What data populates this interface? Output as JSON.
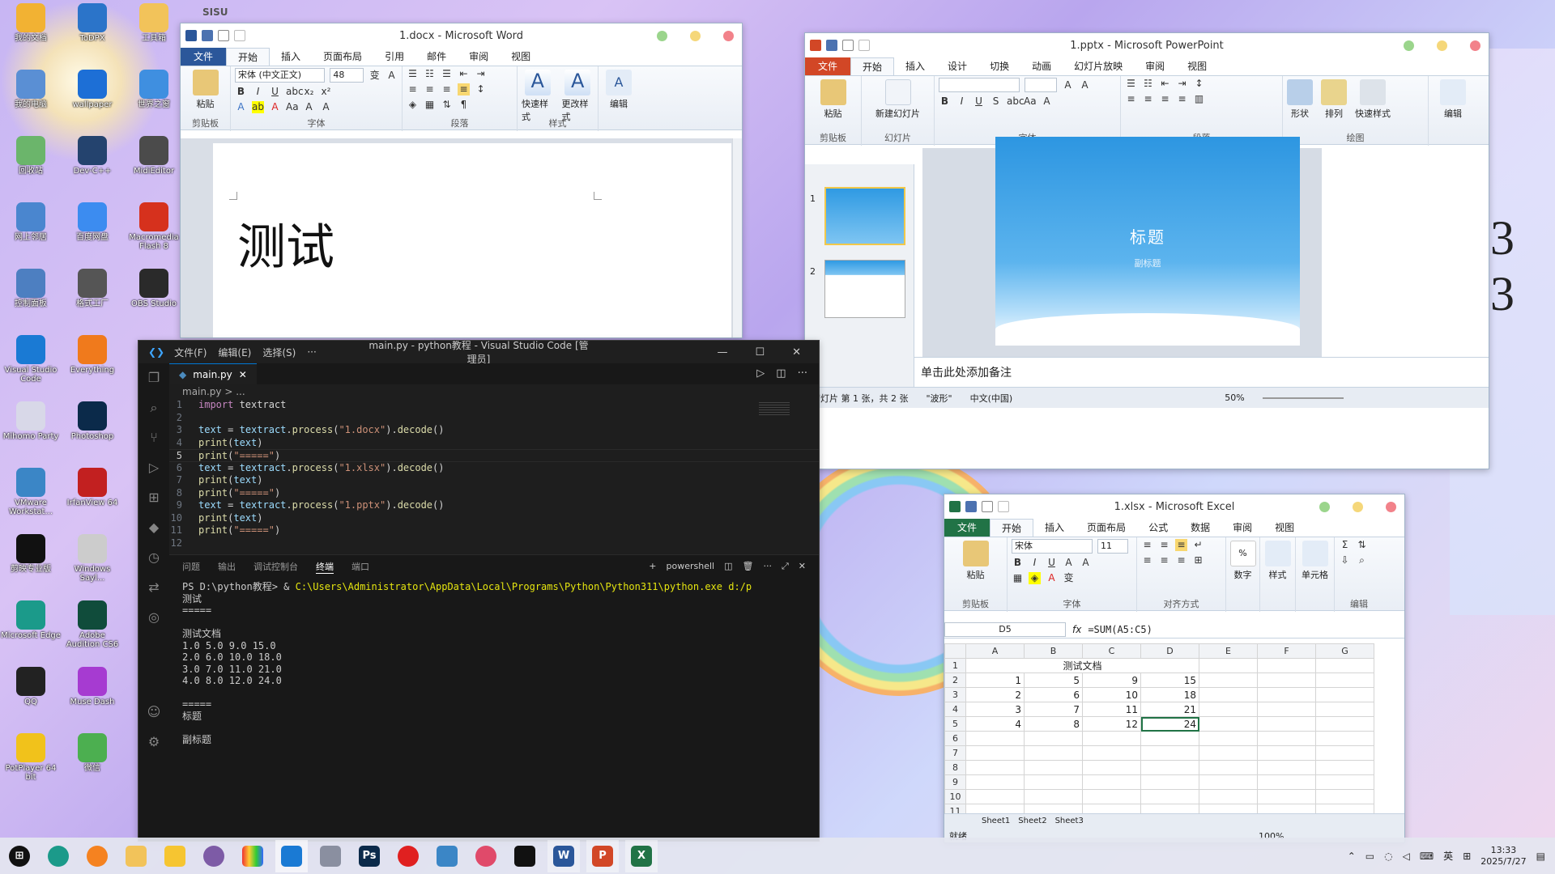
{
  "desktop": {
    "icons": [
      {
        "label": "我的文档",
        "color": "#f2b233"
      },
      {
        "label": "ToDPX",
        "color": "#2b74c9"
      },
      {
        "label": "工具箱",
        "color": "#f2c35a"
      },
      {
        "label": "我的电脑",
        "color": "#5a8fd4"
      },
      {
        "label": "wallpaper",
        "color": "#1d6fd6"
      },
      {
        "label": "世界之窗",
        "color": "#3f8fe0"
      },
      {
        "label": "回收站",
        "color": "#6bb56b"
      },
      {
        "label": "Dev-C++",
        "color": "#24436e"
      },
      {
        "label": "MidiEditor",
        "color": "#4b4b4b"
      },
      {
        "label": "网上邻居",
        "color": "#4a86cf"
      },
      {
        "label": "百度网盘",
        "color": "#3c8cf0"
      },
      {
        "label": "Macromedia Flash 8",
        "color": "#d6311d"
      },
      {
        "label": "控制面板",
        "color": "#4d7fc1"
      },
      {
        "label": "格式工厂",
        "color": "#555555"
      },
      {
        "label": "OBS Studio",
        "color": "#2a2a2a"
      },
      {
        "label": "Visual Studio Code",
        "color": "#1a7ad4"
      },
      {
        "label": "Everything",
        "color": "#f07a1c"
      },
      {
        "label": "",
        "color": "transparent"
      },
      {
        "label": "Mihomo Party",
        "color": "#d8d8e8"
      },
      {
        "label": "Photoshop",
        "color": "#0b2a4a"
      },
      {
        "label": "",
        "color": "transparent"
      },
      {
        "label": "VMware Workstat...",
        "color": "#3b86c6"
      },
      {
        "label": "IrfanView 64",
        "color": "#c22020"
      },
      {
        "label": "",
        "color": "transparent"
      },
      {
        "label": "剪映专业版",
        "color": "#111111"
      },
      {
        "label": "Windows Sayl...",
        "color": "#cccccc"
      },
      {
        "label": "",
        "color": "transparent"
      },
      {
        "label": "Microsoft Edge",
        "color": "#1b9a8a"
      },
      {
        "label": "Adobe Audition CS6",
        "color": "#104c3b"
      },
      {
        "label": "",
        "color": "transparent"
      },
      {
        "label": "QQ",
        "color": "#222222"
      },
      {
        "label": "Muse Dash",
        "color": "#a63bd1"
      },
      {
        "label": "",
        "color": "transparent"
      },
      {
        "label": "PotPlayer 64 bit",
        "color": "#f1c21b"
      },
      {
        "label": "微信",
        "color": "#4caf50"
      },
      {
        "label": "",
        "color": "transparent"
      }
    ]
  },
  "word": {
    "title": "1.docx  -  Microsoft Word",
    "menus": [
      "文件",
      "开始",
      "插入",
      "页面布局",
      "引用",
      "邮件",
      "审阅",
      "视图"
    ],
    "font": "宋体 (中文正文)",
    "size": "48",
    "groups": [
      "剪贴板",
      "字体",
      "段落",
      "样式"
    ],
    "paste": "粘贴",
    "quick_styles": "快速样式",
    "change_styles": "更改样式",
    "edit": "编辑",
    "doc_text": "测试"
  },
  "vscode": {
    "title": "main.py - python教程 - Visual Studio Code [管理员]",
    "menus": [
      "文件(F)",
      "编辑(E)",
      "选择(S)",
      "···"
    ],
    "tab": "main.py",
    "breadcrumb": "main.py > ...",
    "code": [
      [
        {
          "t": "import",
          "c": "kw"
        },
        {
          "t": " textract",
          "c": "pl"
        }
      ],
      [],
      [
        {
          "t": "text",
          "c": "vr"
        },
        {
          "t": " = ",
          "c": "pl"
        },
        {
          "t": "textract",
          "c": "vr"
        },
        {
          "t": ".",
          "c": "pl"
        },
        {
          "t": "process",
          "c": "fn"
        },
        {
          "t": "(",
          "c": "pl"
        },
        {
          "t": "\"1.docx\"",
          "c": "str"
        },
        {
          "t": ").",
          "c": "pl"
        },
        {
          "t": "decode",
          "c": "fn"
        },
        {
          "t": "()",
          "c": "pl"
        }
      ],
      [
        {
          "t": "print",
          "c": "fn"
        },
        {
          "t": "(",
          "c": "pl"
        },
        {
          "t": "text",
          "c": "vr"
        },
        {
          "t": ")",
          "c": "pl"
        }
      ],
      [
        {
          "t": "print",
          "c": "fn"
        },
        {
          "t": "(",
          "c": "pl"
        },
        {
          "t": "\"=====\"",
          "c": "str"
        },
        {
          "t": ")",
          "c": "pl"
        }
      ],
      [
        {
          "t": "text",
          "c": "vr"
        },
        {
          "t": " = ",
          "c": "pl"
        },
        {
          "t": "textract",
          "c": "vr"
        },
        {
          "t": ".",
          "c": "pl"
        },
        {
          "t": "process",
          "c": "fn"
        },
        {
          "t": "(",
          "c": "pl"
        },
        {
          "t": "\"1.xlsx\"",
          "c": "str"
        },
        {
          "t": ").",
          "c": "pl"
        },
        {
          "t": "decode",
          "c": "fn"
        },
        {
          "t": "()",
          "c": "pl"
        }
      ],
      [
        {
          "t": "print",
          "c": "fn"
        },
        {
          "t": "(",
          "c": "pl"
        },
        {
          "t": "text",
          "c": "vr"
        },
        {
          "t": ")",
          "c": "pl"
        }
      ],
      [
        {
          "t": "print",
          "c": "fn"
        },
        {
          "t": "(",
          "c": "pl"
        },
        {
          "t": "\"=====\"",
          "c": "str"
        },
        {
          "t": ")",
          "c": "pl"
        }
      ],
      [
        {
          "t": "text",
          "c": "vr"
        },
        {
          "t": " = ",
          "c": "pl"
        },
        {
          "t": "textract",
          "c": "vr"
        },
        {
          "t": ".",
          "c": "pl"
        },
        {
          "t": "process",
          "c": "fn"
        },
        {
          "t": "(",
          "c": "pl"
        },
        {
          "t": "\"1.pptx\"",
          "c": "str"
        },
        {
          "t": ").",
          "c": "pl"
        },
        {
          "t": "decode",
          "c": "fn"
        },
        {
          "t": "()",
          "c": "pl"
        }
      ],
      [
        {
          "t": "print",
          "c": "fn"
        },
        {
          "t": "(",
          "c": "pl"
        },
        {
          "t": "text",
          "c": "vr"
        },
        {
          "t": ")",
          "c": "pl"
        }
      ],
      [
        {
          "t": "print",
          "c": "fn"
        },
        {
          "t": "(",
          "c": "pl"
        },
        {
          "t": "\"=====\"",
          "c": "str"
        },
        {
          "t": ")",
          "c": "pl"
        }
      ],
      []
    ],
    "panel_tabs": [
      "问题",
      "输出",
      "调试控制台",
      "终端",
      "端口"
    ],
    "shell": "powershell",
    "prompt": "PS D:\\python教程> & ",
    "cmd": "C:\\Users\\Administrator\\AppData\\Local\\Programs\\Python\\Python311\\python.exe d:/p",
    "terminal": [
      "测试",
      "=====",
      "",
      "测试文档",
      "1.0 5.0 9.0 15.0",
      "2.0 6.0 10.0 18.0",
      "3.0 7.0 11.0 21.0",
      "4.0 8.0 12.0 24.0",
      "",
      "=====",
      "标题",
      "",
      "副标题"
    ]
  },
  "ppt": {
    "title": "1.pptx  -  Microsoft PowerPoint",
    "menus": [
      "文件",
      "开始",
      "插入",
      "设计",
      "切换",
      "动画",
      "幻灯片放映",
      "审阅",
      "视图"
    ],
    "groups": [
      "剪贴板",
      "幻灯片",
      "字体",
      "段落",
      "绘图",
      "编辑"
    ],
    "paste": "粘贴",
    "new_slide": "新建幻灯片",
    "shape": "形状",
    "arrange": "排列",
    "quick_styles": "快速样式",
    "edit": "编辑",
    "slide_title": "标题",
    "slide_subtitle": "副标题",
    "notes": "单击此处添加备注",
    "thumbs": [
      "1",
      "2"
    ],
    "status": {
      "slide": "幻灯片 第 1 张，共 2 张",
      "theme": "\"波形\"",
      "lang": "中文(中国)",
      "zoom": "50%"
    }
  },
  "excel": {
    "title": "1.xlsx  -  Microsoft Excel",
    "menus": [
      "文件",
      "开始",
      "插入",
      "页面布局",
      "公式",
      "数据",
      "审阅",
      "视图"
    ],
    "font": "宋体",
    "size": "11",
    "groups": [
      "剪贴板",
      "字体",
      "对齐方式",
      "数字",
      "样式",
      "单元格",
      "编辑"
    ],
    "paste": "粘贴",
    "number": "数字",
    "styles": "样式",
    "cells": "单元格",
    "namebox": "D5",
    "formula": "=SUM(A5:C5)",
    "cols": [
      "A",
      "B",
      "C",
      "D",
      "E",
      "F",
      "G"
    ],
    "title_cell": "测试文档",
    "rows": [
      [
        "1",
        "5",
        "9",
        "15"
      ],
      [
        "2",
        "6",
        "10",
        "18"
      ],
      [
        "3",
        "7",
        "11",
        "21"
      ],
      [
        "4",
        "8",
        "12",
        "24"
      ]
    ],
    "rownums": [
      "1",
      "2",
      "3",
      "4",
      "5",
      "6",
      "7",
      "8",
      "9",
      "10",
      "11"
    ],
    "sheets": [
      "Sheet1",
      "Sheet2",
      "Sheet3"
    ],
    "status": "就绪",
    "zoom": "100%"
  },
  "taskbar": {
    "time": "13:33",
    "date": "2025/7/27",
    "lang": "英"
  }
}
